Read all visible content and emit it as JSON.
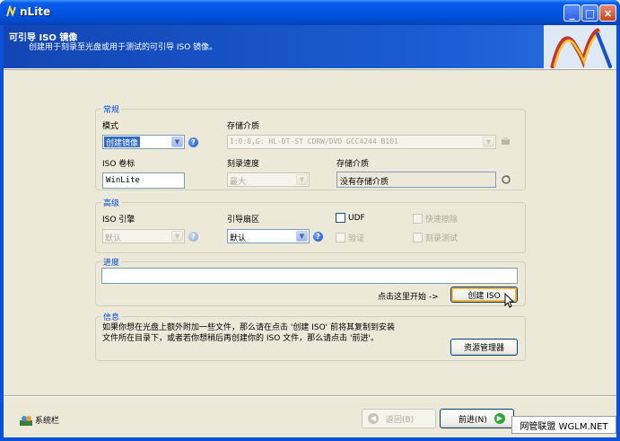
{
  "window": {
    "title": "nLite",
    "controls": {
      "minimize": "_",
      "maximize": "□",
      "close": "×"
    }
  },
  "banner": {
    "title": "可引导 ISO 镜像",
    "subtitle": "创建用于刻录至光盘或用于测试的可引导 ISO 镜像。"
  },
  "general": {
    "title": "常规",
    "mode_label": "模式",
    "mode_value": "创建镜像",
    "storage_label": "存储介质",
    "storage_value": "1:0:0,G: HL-DT-ST CDRW/DVD GCC4244 B101",
    "iso_label_label": "ISO 卷标",
    "iso_label_value": "WinLite",
    "burn_speed_label": "刻录速度",
    "burn_speed_value": "最大",
    "media_label": "存储介质",
    "media_value": "没有存储介质"
  },
  "advanced": {
    "title": "高级",
    "iso_engine_label": "ISO 引擎",
    "iso_engine_value": "默认",
    "boot_sector_label": "引导扇区",
    "boot_sector_value": "默认",
    "udf_label": "UDF",
    "quick_erase_label": "快速擦除",
    "verify_label": "验证",
    "burn_test_label": "刻录测试"
  },
  "progress": {
    "title": "进度",
    "click_hint": "点击这里开始 ->",
    "create_iso_button": "创建 ISO",
    "fraction": 0
  },
  "info": {
    "title": "信息",
    "line1": "如果你想在光盘上额外附加一些文件，那么请在点击 '创建 ISO' 前将其复制到安装",
    "line2": "文件所在目录下，或者若你想稍后再创建你的 ISO 文件，那么请点击 '前进'。",
    "explorer_button": "资源管理器"
  },
  "footer": {
    "tray_label": "系统栏",
    "back_button": "返回(B)",
    "next_button": "前进(N)"
  },
  "watermark": "网管联盟 WGLM.NET",
  "colors": {
    "title_bar": "#0054e3",
    "banner": "#1a5cd3",
    "group_title": "#0046d5",
    "face": "#ece9d8"
  },
  "icons": {
    "app": "nlite-icon",
    "help": "help-icon",
    "refresh": "refresh-icon",
    "tray": "tray-icon",
    "back": "back-arrow-icon",
    "next": "next-arrow-icon"
  }
}
